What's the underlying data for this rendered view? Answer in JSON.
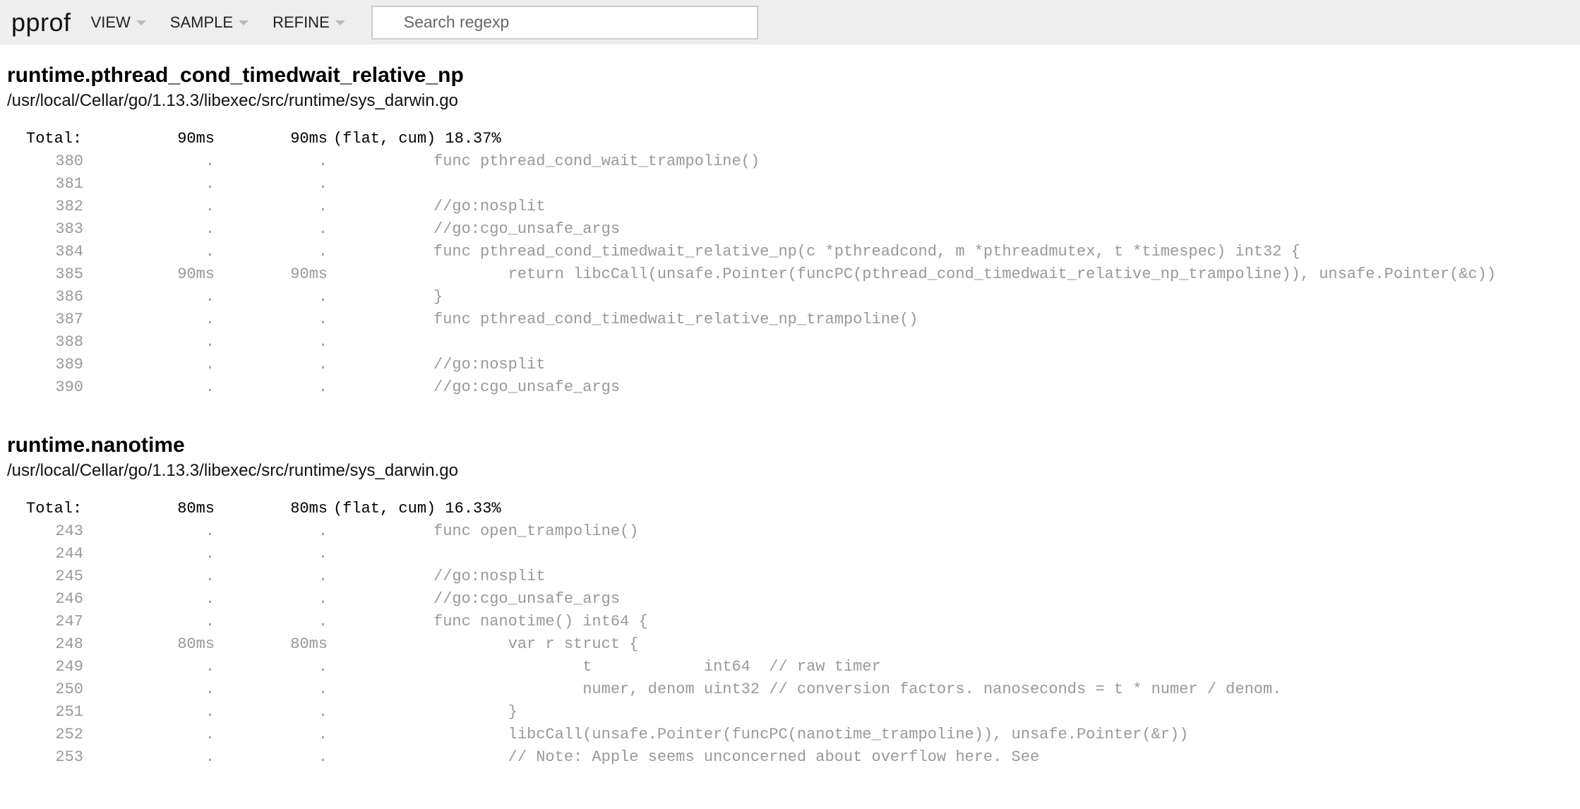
{
  "header": {
    "logo": "pprof",
    "menus": [
      "VIEW",
      "SAMPLE",
      "REFINE"
    ],
    "search_placeholder": "Search regexp"
  },
  "sections": [
    {
      "title": "runtime.pthread_cond_timedwait_relative_np",
      "file": "/usr/local/Cellar/go/1.13.3/libexec/src/runtime/sys_darwin.go",
      "total": {
        "label": "Total:",
        "flat": "90ms",
        "cum": "90ms",
        "rest": "(flat, cum) 18.37%"
      },
      "lines": [
        {
          "ln": "380",
          "flat": ".",
          "cum": ".",
          "src": "func pthread_cond_wait_trampoline()"
        },
        {
          "ln": "381",
          "flat": ".",
          "cum": ".",
          "src": ""
        },
        {
          "ln": "382",
          "flat": ".",
          "cum": ".",
          "src": "//go:nosplit"
        },
        {
          "ln": "383",
          "flat": ".",
          "cum": ".",
          "src": "//go:cgo_unsafe_args"
        },
        {
          "ln": "384",
          "flat": ".",
          "cum": ".",
          "src": "func pthread_cond_timedwait_relative_np(c *pthreadcond, m *pthreadmutex, t *timespec) int32 {"
        },
        {
          "ln": "385",
          "flat": "90ms",
          "cum": "90ms",
          "src": "        return libcCall(unsafe.Pointer(funcPC(pthread_cond_timedwait_relative_np_trampoline)), unsafe.Pointer(&c))"
        },
        {
          "ln": "386",
          "flat": ".",
          "cum": ".",
          "src": "}"
        },
        {
          "ln": "387",
          "flat": ".",
          "cum": ".",
          "src": "func pthread_cond_timedwait_relative_np_trampoline()"
        },
        {
          "ln": "388",
          "flat": ".",
          "cum": ".",
          "src": ""
        },
        {
          "ln": "389",
          "flat": ".",
          "cum": ".",
          "src": "//go:nosplit"
        },
        {
          "ln": "390",
          "flat": ".",
          "cum": ".",
          "src": "//go:cgo_unsafe_args"
        }
      ]
    },
    {
      "title": "runtime.nanotime",
      "file": "/usr/local/Cellar/go/1.13.3/libexec/src/runtime/sys_darwin.go",
      "total": {
        "label": "Total:",
        "flat": "80ms",
        "cum": "80ms",
        "rest": "(flat, cum) 16.33%"
      },
      "lines": [
        {
          "ln": "243",
          "flat": ".",
          "cum": ".",
          "src": "func open_trampoline()"
        },
        {
          "ln": "244",
          "flat": ".",
          "cum": ".",
          "src": ""
        },
        {
          "ln": "245",
          "flat": ".",
          "cum": ".",
          "src": "//go:nosplit"
        },
        {
          "ln": "246",
          "flat": ".",
          "cum": ".",
          "src": "//go:cgo_unsafe_args"
        },
        {
          "ln": "247",
          "flat": ".",
          "cum": ".",
          "src": "func nanotime() int64 {"
        },
        {
          "ln": "248",
          "flat": "80ms",
          "cum": "80ms",
          "src": "        var r struct {"
        },
        {
          "ln": "249",
          "flat": ".",
          "cum": ".",
          "src": "                t            int64  // raw timer"
        },
        {
          "ln": "250",
          "flat": ".",
          "cum": ".",
          "src": "                numer, denom uint32 // conversion factors. nanoseconds = t * numer / denom."
        },
        {
          "ln": "251",
          "flat": ".",
          "cum": ".",
          "src": "        }"
        },
        {
          "ln": "252",
          "flat": ".",
          "cum": ".",
          "src": "        libcCall(unsafe.Pointer(funcPC(nanotime_trampoline)), unsafe.Pointer(&r))"
        },
        {
          "ln": "253",
          "flat": ".",
          "cum": ".",
          "src": "        // Note: Apple seems unconcerned about overflow here. See"
        }
      ]
    }
  ]
}
